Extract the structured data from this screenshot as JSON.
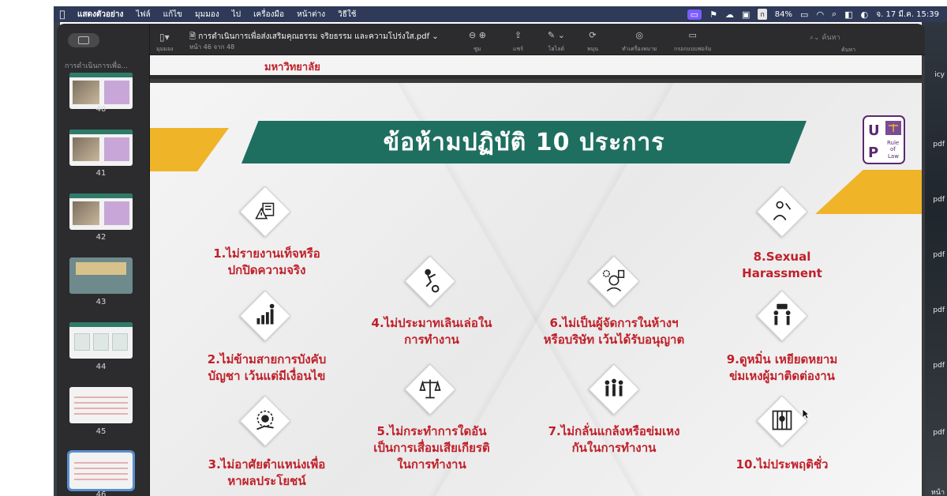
{
  "menubar": {
    "apple": "",
    "items": [
      "แสดงตัวอย่าง",
      "ไฟล์",
      "แก้ไข",
      "มุมมอง",
      "ไป",
      "เครื่องมือ",
      "หน้าต่าง",
      "วิธีใช้"
    ],
    "battery": "84%",
    "input_method": "ก",
    "datetime": "จ. 17 มี.ค. 15:39"
  },
  "window": {
    "toolbar": {
      "sidebar_label": "มุมมอง",
      "doc_title": "การดำเนินการเพื่อส่งเสริมคุณธรรม จริยธรรม และความโปร่งใส.pdf",
      "page_info": "หน้า 46 จาก 48",
      "zoom_label": "ซูม",
      "share_label": "แชร์",
      "highlight_label": "ไฮไลต์",
      "rotate_label": "หมุน",
      "markup_label": "ทำเครื่องหมาย",
      "form_label": "กรอกแบบฟอร์ม",
      "search_placeholder": "ค้นหา",
      "search_label": "ค้นหา"
    },
    "sidebar": {
      "doc_title": "การดำเนินการเพื่อ...",
      "thumbnails": [
        {
          "page": "40"
        },
        {
          "page": "41"
        },
        {
          "page": "42"
        },
        {
          "page": "43"
        },
        {
          "page": "44"
        },
        {
          "page": "45"
        },
        {
          "page": "46"
        }
      ]
    },
    "prev_page_text": "มหาวิทยาลัย",
    "slide": {
      "title": "ข้อห้ามปฏิบัติ 10 ประการ",
      "logo": {
        "text": "UP",
        "sub1": "Rule",
        "sub2": "of",
        "sub3": "Law"
      },
      "items": [
        {
          "line1": "1.ไม่รายงานเท็จหรือ",
          "line2": "ปกปิดความจริง",
          "icon": "report-warning-icon"
        },
        {
          "line1": "2.ไม่ข้ามสายการบังคับ",
          "line2": "บัญชา เว้นแต่มีเงื่อนไข",
          "icon": "growth-chart-icon"
        },
        {
          "line1": "3.ไม่อาศัยตำแหน่งเพื่อ",
          "line2": "หาผลประโยชน์",
          "icon": "hand-coin-icon"
        },
        {
          "line1": "4.ไม่ประมาทเลินเล่อใน",
          "line2": "การทำงาน",
          "icon": "person-falling-icon"
        },
        {
          "line1": "5.ไม่กระทำการใดอัน",
          "line2": "เป็นการเสื่อมเสียเกียรติ",
          "line3": "ในการทำงาน",
          "icon": "balance-scale-icon"
        },
        {
          "line1": "6.ไม่เป็นผู้จัดการในห้างฯ",
          "line2": "หรือบริษัท เว้นได้รับอนุญาต",
          "icon": "manager-gear-icon"
        },
        {
          "line1": "7.ไม่กลั่นแกล้งหรือข่มเหง",
          "line2": "กันในการทำงาน",
          "icon": "bullying-icon"
        },
        {
          "line1": "8.Sexual",
          "line2": "Harassment",
          "icon": "harassment-icon"
        },
        {
          "line1": "9.ดูหมิ่น เหยียดหยาม",
          "line2": "ข่มเหงผู้มาติดต่องาน",
          "icon": "argument-icon"
        },
        {
          "line1": "10.ไม่ประพฤติชั่ว",
          "icon": "prisoner-icon"
        }
      ]
    }
  },
  "desktop_labels": [
    "icy",
    "pdf",
    "pdf",
    "pdf",
    "pdf",
    "pdf",
    "pdf",
    "หน้า"
  ],
  "colors": {
    "banner": "#1f6f60",
    "accent_gold": "#f0b429",
    "item_text": "#c0202a",
    "menubar": "#2e3a58"
  }
}
